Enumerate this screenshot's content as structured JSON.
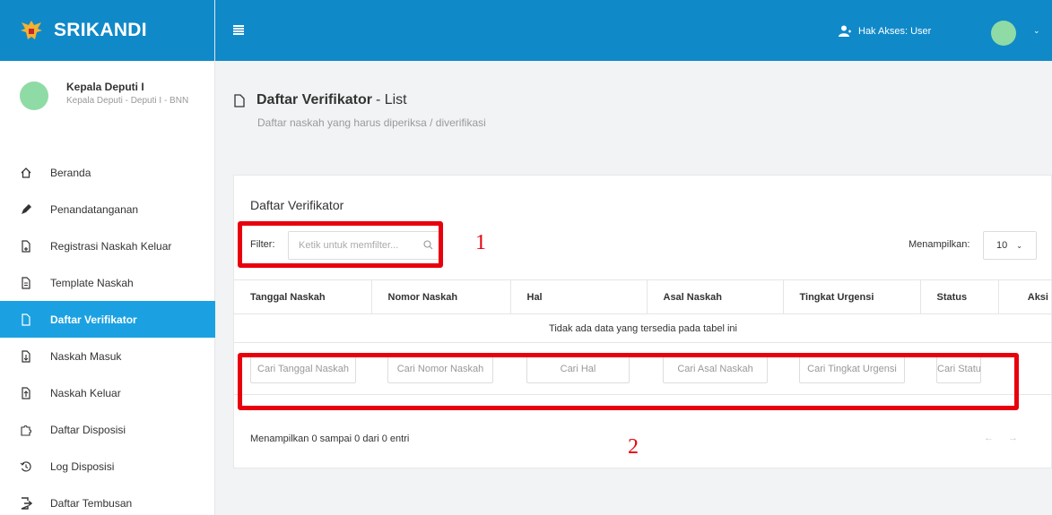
{
  "brand": {
    "name": "SRIKANDI"
  },
  "user": {
    "name": "Kepala Deputi I",
    "role": "Kepala Deputi - Deputi I - BNN"
  },
  "nav": [
    {
      "label": "Beranda",
      "icon": "home-icon",
      "active": false
    },
    {
      "label": "Penandatanganan",
      "icon": "pen-icon",
      "active": false
    },
    {
      "label": "Registrasi Naskah Keluar",
      "icon": "file-plus-icon",
      "active": false
    },
    {
      "label": "Template Naskah",
      "icon": "file-text-icon",
      "active": false
    },
    {
      "label": "Daftar Verifikator",
      "icon": "file-check-icon",
      "active": true
    },
    {
      "label": "Naskah Masuk",
      "icon": "file-download-icon",
      "active": false
    },
    {
      "label": "Naskah Keluar",
      "icon": "file-upload-icon",
      "active": false
    },
    {
      "label": "Daftar Disposisi",
      "icon": "puzzle-icon",
      "active": false
    },
    {
      "label": "Log Disposisi",
      "icon": "history-icon",
      "active": false
    },
    {
      "label": "Daftar Tembusan",
      "icon": "forward-icon",
      "active": false
    }
  ],
  "topbar": {
    "access_label": "Hak Akses: User"
  },
  "page": {
    "title_bold": "Daftar Verifikator",
    "title_suffix": "- List",
    "subtitle": "Daftar naskah yang harus diperiksa / diverifikasi"
  },
  "card": {
    "title": "Daftar Verifikator",
    "filter_label": "Filter:",
    "filter_placeholder": "Ketik untuk memfilter...",
    "show_label": "Menampilkan:",
    "show_value": "10",
    "columns": [
      "Tanggal Naskah",
      "Nomor Naskah",
      "Hal",
      "Asal Naskah",
      "Tingkat Urgensi",
      "Status",
      "Aksi"
    ],
    "empty_message": "Tidak ada data yang tersedia pada tabel ini",
    "search_placeholders": [
      "Cari Tanggal Naskah",
      "Cari Nomor Naskah",
      "Cari Hal",
      "Cari Asal Naskah",
      "Cari Tingkat Urgensi",
      "Cari Status"
    ],
    "info": "Menampilkan 0 sampai 0 dari 0 entri",
    "prev": "←",
    "next": "→"
  },
  "annotations": {
    "first": "1",
    "second": "2"
  },
  "colors": {
    "topbar": "#1089c9",
    "active_nav": "#1ba1e2",
    "annotation": "#e8000d",
    "avatar": "#8fdba5"
  }
}
